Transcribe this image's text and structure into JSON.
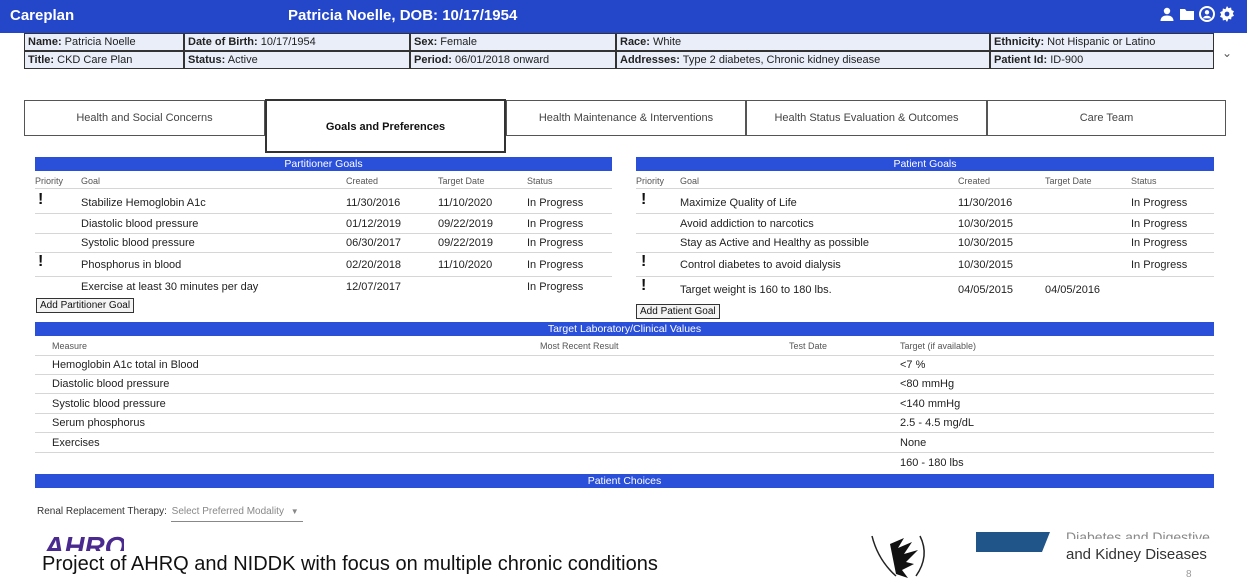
{
  "topbar": {
    "app_title": "Careplan",
    "patient_title": "Patricia Noelle, DOB: 10/17/1954",
    "icons": [
      "user-icon",
      "folder-icon",
      "account-circle-icon",
      "gear-icon"
    ]
  },
  "info": {
    "name_label": "Name:",
    "name_value": " Patricia Noelle",
    "dob_label": "Date of Birth:",
    "dob_value": " 10/17/1954",
    "sex_label": "Sex:",
    "sex_value": " Female",
    "race_label": "Race:",
    "race_value": " White",
    "ethnicity_label": "Ethnicity:",
    "ethnicity_value": " Not Hispanic or Latino",
    "title_label": "Title:",
    "title_value": " CKD Care Plan",
    "status_label": "Status:",
    "status_value": " Active",
    "period_label": "Period:",
    "period_value": " 06/01/2018 onward",
    "addresses_label": "Addresses:",
    "addresses_value": " Type 2 diabetes, Chronic kidney disease",
    "patientid_label": "Patient Id:",
    "patientid_value": " ID-900"
  },
  "tabs": [
    "Health and Social Concerns",
    "Goals and Preferences",
    "Health Maintenance & Interventions",
    "Health Status Evaluation & Outcomes",
    "Care Team"
  ],
  "practitioner_goals": {
    "header": "Partitioner Goals",
    "columns": [
      "Priority",
      "Goal",
      "Created",
      "Target Date",
      "Status"
    ],
    "rows": [
      {
        "priority": "!",
        "goal": "Stabilize Hemoglobin A1c",
        "created": "11/30/2016",
        "target": "11/10/2020",
        "status": "In Progress"
      },
      {
        "priority": "",
        "goal": "Diastolic blood pressure",
        "created": "01/12/2019",
        "target": "09/22/2019",
        "status": "In Progress"
      },
      {
        "priority": "",
        "goal": "Systolic blood pressure",
        "created": "06/30/2017",
        "target": "09/22/2019",
        "status": "In Progress"
      },
      {
        "priority": "!",
        "goal": "Phosphorus in blood",
        "created": "02/20/2018",
        "target": "11/10/2020",
        "status": "In Progress"
      },
      {
        "priority": "",
        "goal": "Exercise at least 30 minutes per day",
        "created": "12/07/2017",
        "target": "",
        "status": "In Progress"
      }
    ],
    "add_button": "Add Partitioner Goal"
  },
  "patient_goals": {
    "header": "Patient Goals",
    "columns": [
      "Priority",
      "Goal",
      "Created",
      "Target Date",
      "Status"
    ],
    "rows": [
      {
        "priority": "!",
        "goal": "Maximize Quality of Life",
        "created": "11/30/2016",
        "target": "",
        "status": "In Progress"
      },
      {
        "priority": "",
        "goal": "Avoid addiction to narcotics",
        "created": "10/30/2015",
        "target": "",
        "status": "In Progress"
      },
      {
        "priority": "",
        "goal": "Stay as Active and Healthy as possible",
        "created": "10/30/2015",
        "target": "",
        "status": "In Progress"
      },
      {
        "priority": "!",
        "goal": "Control diabetes to avoid dialysis",
        "created": "10/30/2015",
        "target": "",
        "status": "In Progress"
      },
      {
        "priority": "!",
        "goal": "Target weight is 160 to 180 lbs.",
        "created": "04/05/2015",
        "target": "04/05/2016",
        "status": ""
      }
    ],
    "add_button": "Add Patient Goal"
  },
  "lab_values": {
    "header": "Target Laboratory/Clinical Values",
    "columns": [
      "Measure",
      "Most Recent Result",
      "Test Date",
      "Target (if available)"
    ],
    "rows": [
      {
        "measure": "Hemoglobin A1c total in Blood",
        "target": "<7 %"
      },
      {
        "measure": "Diastolic blood pressure",
        "target": "<80 mmHg"
      },
      {
        "measure": "Systolic blood pressure",
        "target": "<140 mmHg"
      },
      {
        "measure": "Serum phosphorus",
        "target": "2.5 - 4.5 mg/dL"
      },
      {
        "measure": "Exercises",
        "target": "None"
      },
      {
        "measure": "",
        "target": "160 - 180 lbs"
      }
    ]
  },
  "patient_choices": {
    "header": "Patient Choices",
    "rrt_label": "Renal Replacement Therapy:",
    "rrt_placeholder": "Select Preferred Modality"
  },
  "footer": {
    "ahrq_logo_text": "AHRQ",
    "caption": "Project of AHRQ and NIDDK with focus on multiple chronic conditions",
    "niddk_top_text": "Diabetes and Digestive",
    "niddk_text": "and Kidney Diseases",
    "page_number": "8"
  }
}
